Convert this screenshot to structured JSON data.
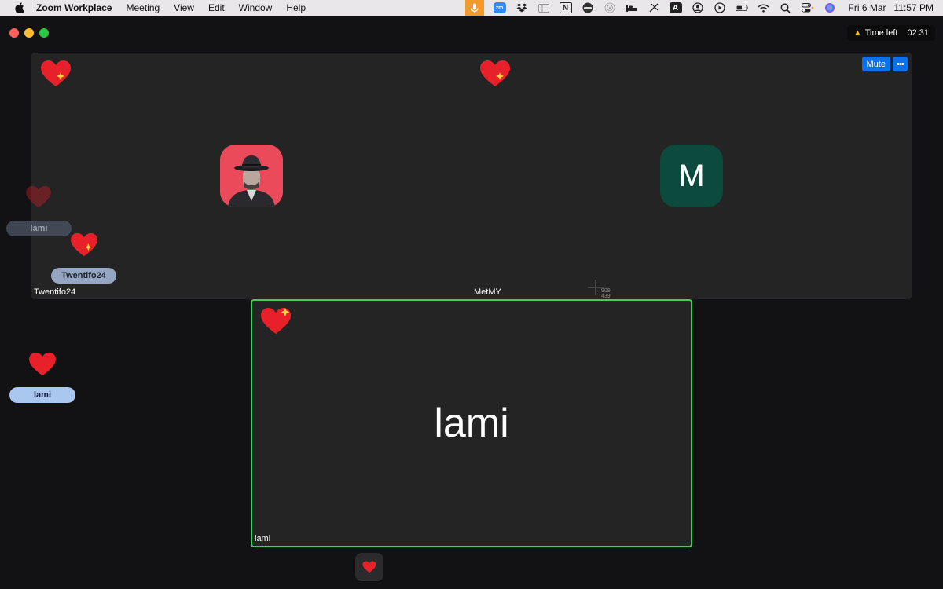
{
  "menubar": {
    "app_name": "Zoom Workplace",
    "menus": [
      "Meeting",
      "View",
      "Edit",
      "Window",
      "Help"
    ],
    "tray": {
      "zoom_label": "zm",
      "notion_label": "N",
      "input_label": "A"
    },
    "date": "Fri 6 Mar",
    "time": "11:57 PM"
  },
  "meeting": {
    "time_left_label": "Time left",
    "time_left_value": "02:31",
    "mute_label": "Mute",
    "more_label": "•••",
    "participants": [
      {
        "name": "Twentifo24",
        "avatar": "photo"
      },
      {
        "name": "MetMY",
        "avatar_initial": "M"
      }
    ],
    "active_speaker": {
      "name": "lami"
    }
  },
  "reactions": {
    "pills": [
      "lami",
      "Twentifo24",
      "lami"
    ]
  },
  "cursor": {
    "x_readout": "909",
    "y_readout": "439"
  },
  "colors": {
    "speaker_border": "#3ed15a",
    "accent_blue": "#0e71eb",
    "mic_active": "#f39a2b",
    "heart": "#e8202a",
    "initial_avatar": "#0c4a3d"
  }
}
